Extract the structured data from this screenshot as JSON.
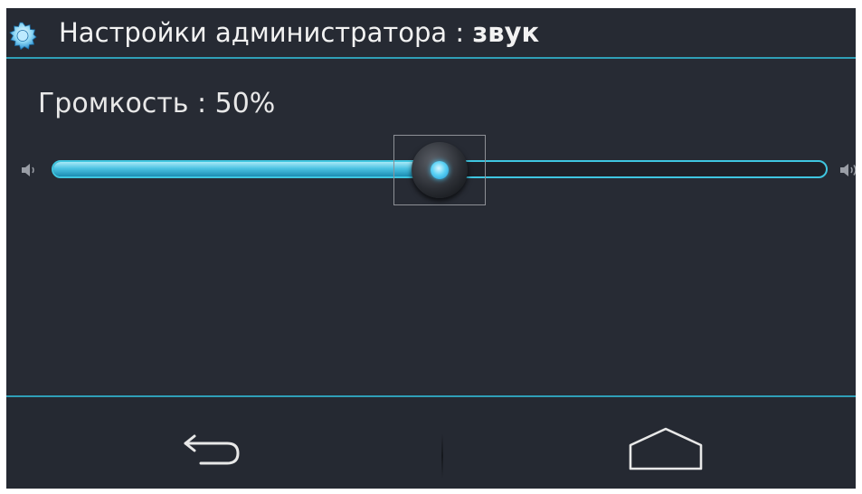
{
  "header": {
    "title_prefix": "Настройки администратора : ",
    "title_section": "звук",
    "icon": "gear-icon"
  },
  "volume": {
    "label": "Громкость : 50%",
    "value": 50,
    "min_icon": "volume-low-icon",
    "max_icon": "volume-high-icon"
  },
  "navigation": {
    "back_icon": "back-arrow-icon",
    "home_icon": "home-icon"
  },
  "colors": {
    "background": "#272b34",
    "accent": "#3fc6e0",
    "text": "#f2f2f2"
  }
}
